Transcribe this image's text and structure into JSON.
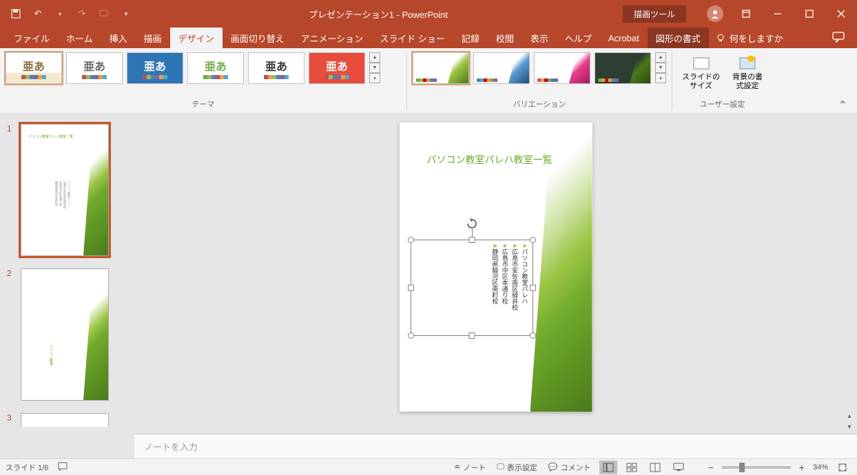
{
  "titlebar": {
    "doc_title": "プレゼンテーション1 - PowerPoint",
    "drawing_tools": "描画ツール"
  },
  "menu": {
    "file": "ファイル",
    "home": "ホーム",
    "insert": "挿入",
    "draw": "描画",
    "design": "デザイン",
    "transitions": "画面切り替え",
    "animations": "アニメーション",
    "slideshow": "スライド ショー",
    "record": "記録",
    "review": "校閲",
    "view": "表示",
    "help": "ヘルプ",
    "acrobat": "Acrobat",
    "format": "図形の書式",
    "tellme": "何をしますか"
  },
  "ribbon": {
    "themes_label": "テーマ",
    "variations_label": "バリエーション",
    "customize_label": "ユーザー設定",
    "slide_size": "スライドの\nサイズ",
    "bg_format": "背景の書\n式設定",
    "sample_text": "亜あ"
  },
  "thumbnails": {
    "slide1_num": "1",
    "slide2_num": "2",
    "slide3_num": "3",
    "slide1_title": "パソコン教室パレハ教室一覧",
    "slide1_body": "パソコン教室パレハ\n広島市安佐南区緑井校\n広島市中区本通り校\n静岡県駿河区南町校"
  },
  "slide": {
    "title": "パソコン教室パレハ教室一覧",
    "bullets": [
      "パソコン教室パレハ",
      "広島市安佐南区緑井校",
      "広島市中区本通り校",
      "静岡県駿河区南町校"
    ]
  },
  "notes": {
    "placeholder": "ノートを入力"
  },
  "statusbar": {
    "slide_indicator": "スライド 1/6",
    "notes_btn": "ノート",
    "display_settings": "表示設定",
    "comments_btn": "コメント",
    "zoom_pct": "34%"
  },
  "colors": {
    "accent": "#b7472a",
    "green1": "#9ac544",
    "green2": "#6faa2c",
    "green3": "#4a7a1a"
  }
}
